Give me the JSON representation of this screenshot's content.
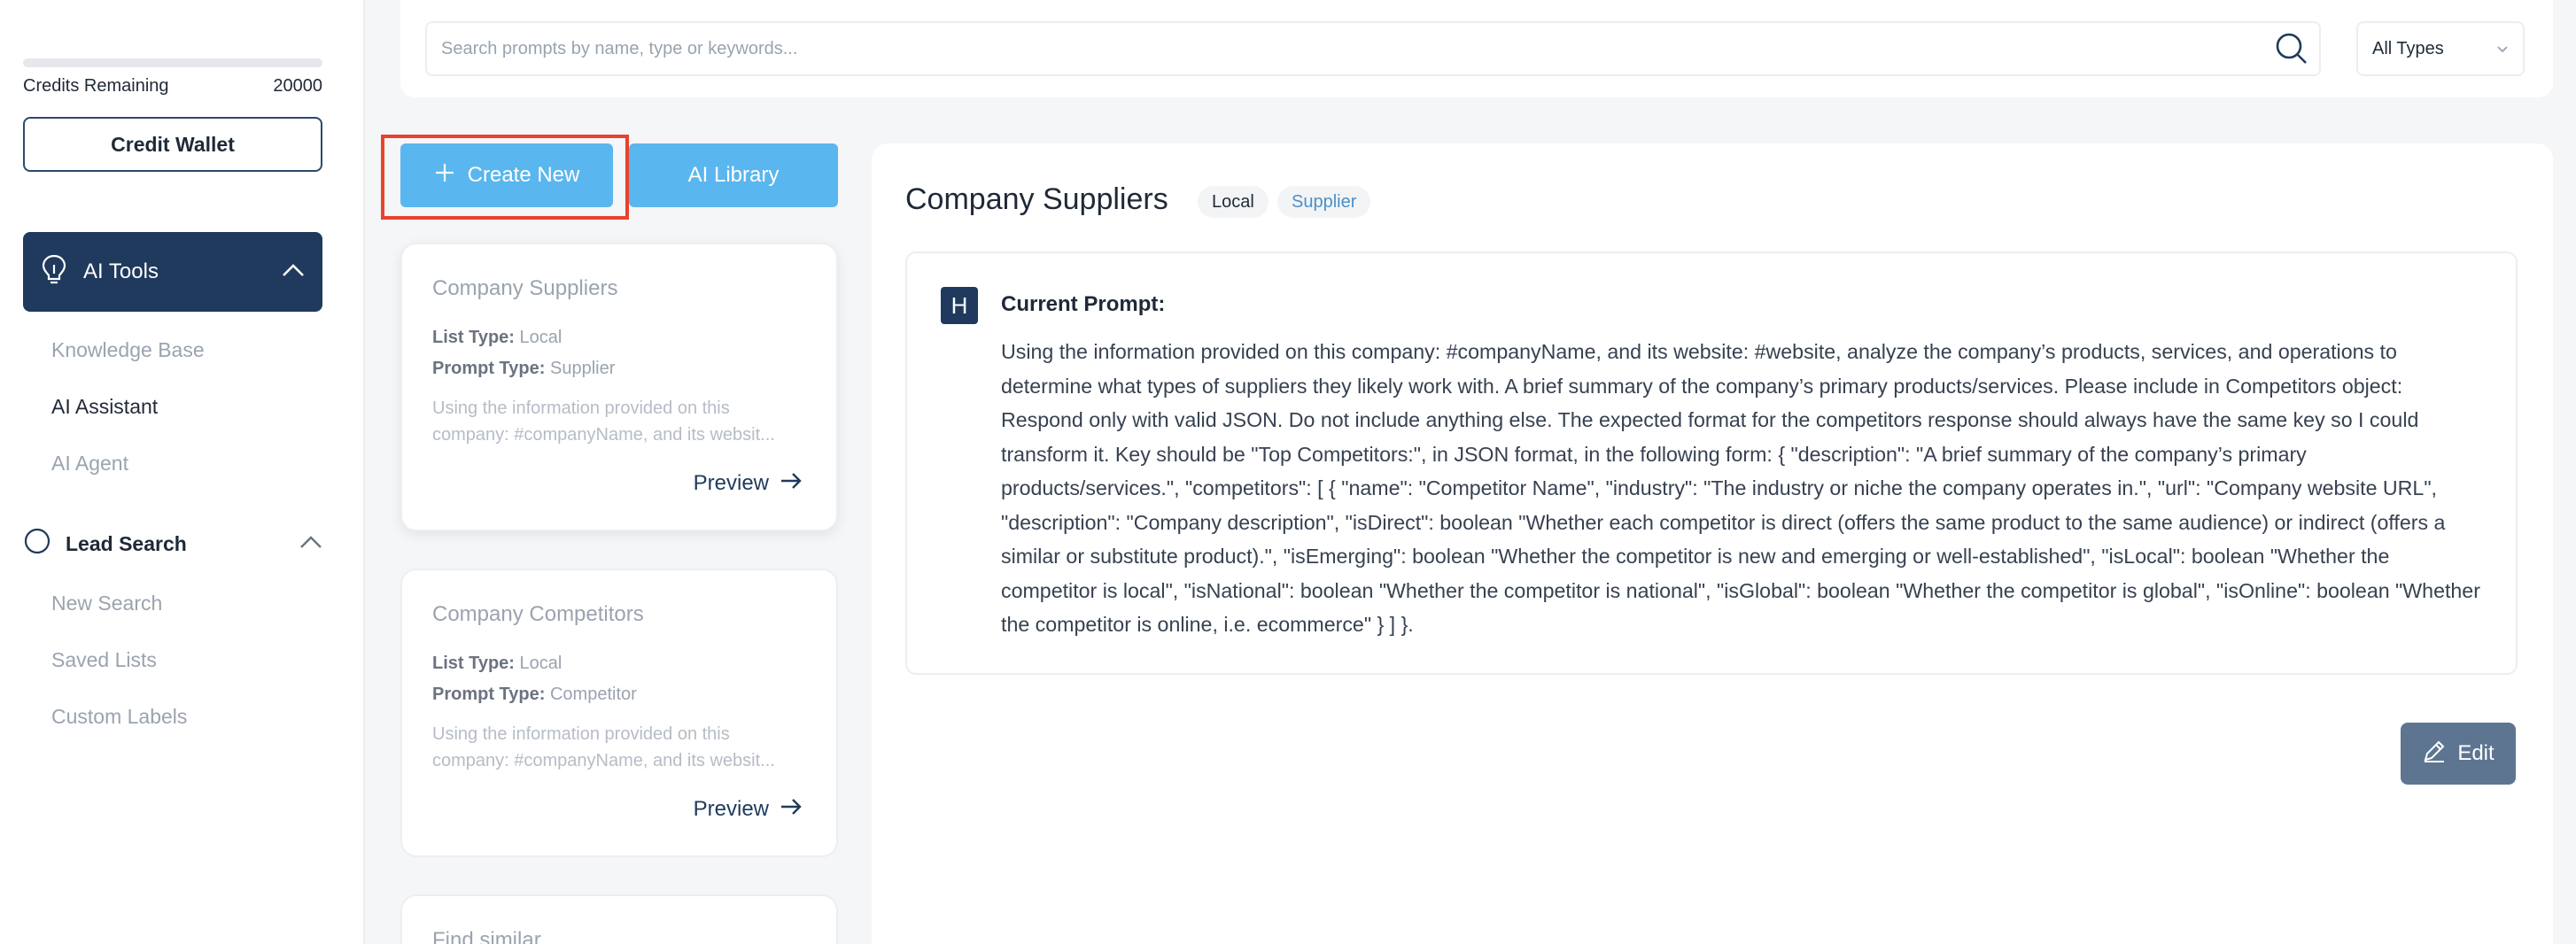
{
  "sidebar": {
    "credits_label": "Credits Remaining",
    "credits_value": "20000",
    "wallet_label": "Credit Wallet",
    "ai_tools_label": "AI Tools",
    "ai_tools_items": [
      {
        "label": "Knowledge Base"
      },
      {
        "label": "AI Assistant"
      },
      {
        "label": "AI Agent"
      }
    ],
    "lead_search_label": "Lead Search",
    "lead_search_items": [
      {
        "label": "New Search"
      },
      {
        "label": "Saved Lists"
      },
      {
        "label": "Custom Labels"
      }
    ]
  },
  "search": {
    "placeholder": "Search prompts by name, type or keywords...",
    "type_filter": "All Types"
  },
  "actions": {
    "create_label": "Create New",
    "library_label": "AI Library"
  },
  "cards": [
    {
      "title": "Company Suppliers",
      "list_type_label": "List Type:",
      "list_type": "Local",
      "prompt_type_label": "Prompt Type:",
      "prompt_type": "Supplier",
      "desc": "Using the information provided on this company: #companyName, and its websit...",
      "preview": "Preview"
    },
    {
      "title": "Company Competitors",
      "list_type_label": "List Type:",
      "list_type": "Local",
      "prompt_type_label": "Prompt Type:",
      "prompt_type": "Competitor",
      "desc": "Using the information provided on this company: #companyName, and its websit...",
      "preview": "Preview"
    },
    {
      "title": "Find similar"
    }
  ],
  "detail": {
    "title": "Company Suppliers",
    "badge_local": "Local",
    "badge_type": "Supplier",
    "avatar_letter": "H",
    "prompt_label": "Current Prompt:",
    "prompt_text": "Using the information provided on this company: #companyName, and its website: #website, analyze the company’s products, services, and operations to determine what types of suppliers they likely work with. A brief summary of the company’s primary products/services. Please include in Competitors object: Respond only with valid JSON. Do not include anything else. The expected format for the competitors response should always have the same key so I could transform it. Key should be \"Top Competitors:\", in JSON format, in the following form: { \"description\": \"A brief summary of the company’s primary products/services.\", \"competitors\": [ { \"name\": \"Competitor Name\", \"industry\": \"The industry or niche the company operates in.\", \"url\": \"Company website URL\", \"description\": \"Company description\", \"isDirect\": boolean \"Whether each competitor is direct (offers the same product to the same audience) or indirect (offers a similar or substitute product).\", \"isEmerging\": boolean \"Whether the competitor is new and emerging or well-established\", \"isLocal\": boolean \"Whether the competitor is local\", \"isNational\": boolean \"Whether the competitor is national\", \"isGlobal\": boolean \"Whether the competitor is global\", \"isOnline\": boolean \"Whether the competitor is online, i.e. ecommerce\" } ] }.",
    "edit_label": "Edit"
  },
  "colors": {
    "accent": "#5ab6ee",
    "navy": "#1f3a5c",
    "highlight": "#e8432d"
  }
}
